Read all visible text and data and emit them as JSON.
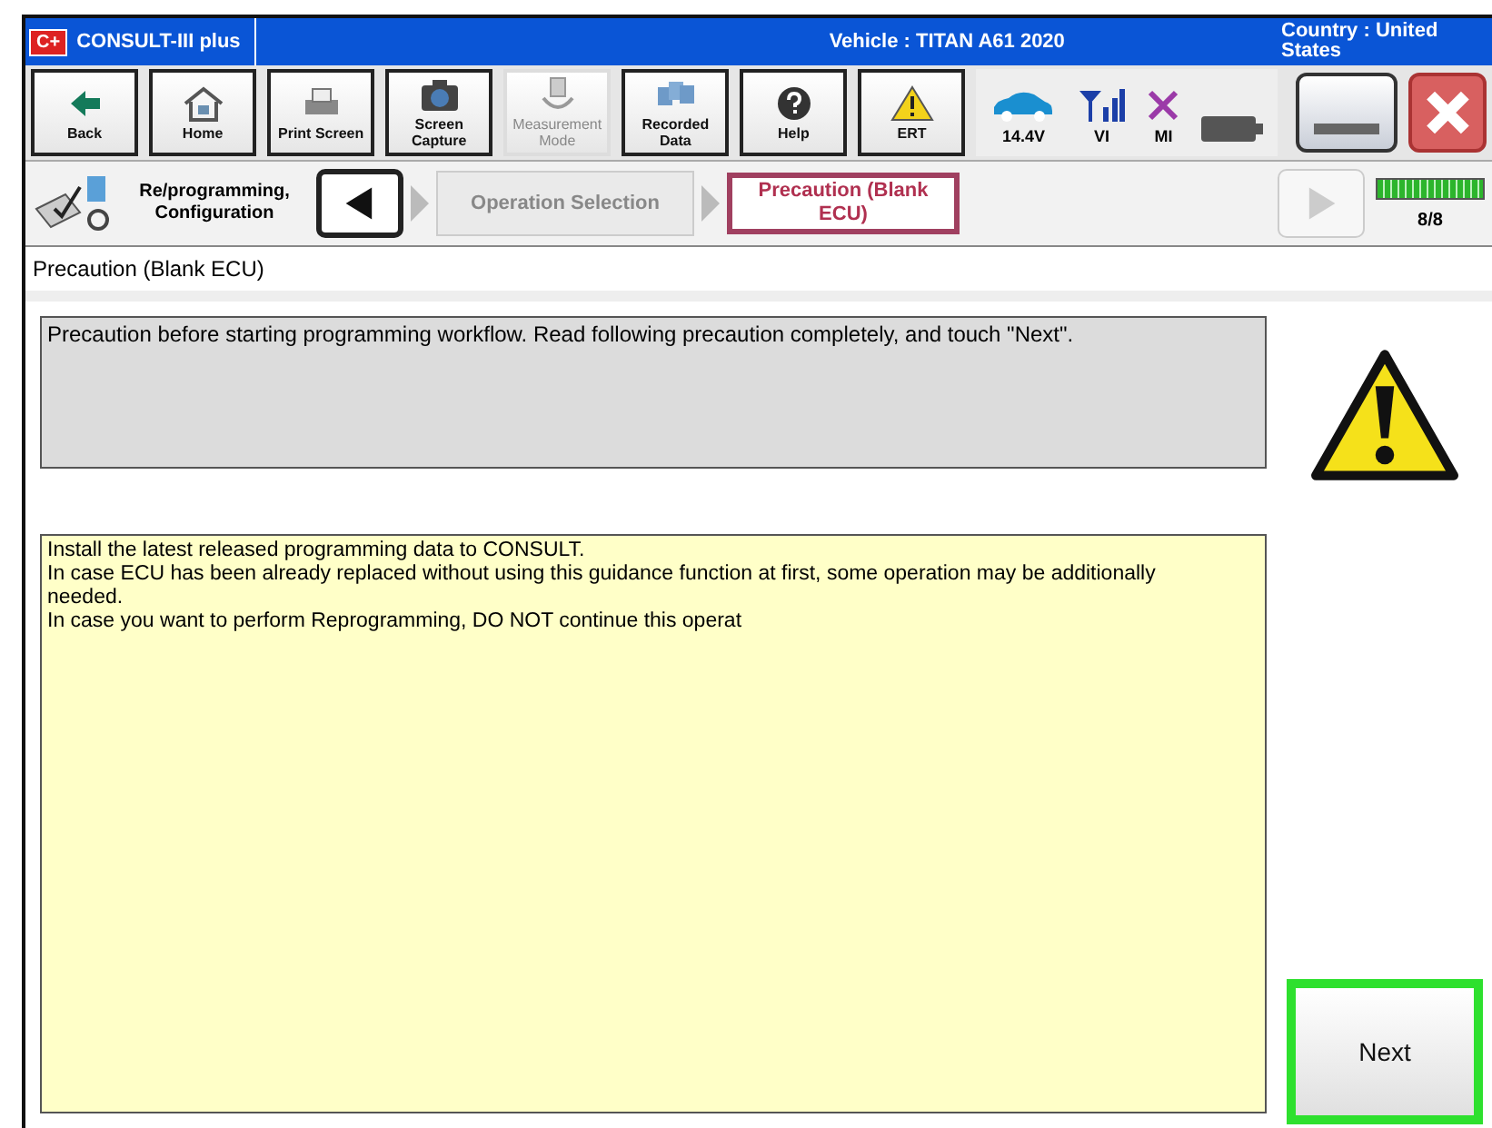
{
  "window": {
    "logo": "C+",
    "app_title": "CONSULT-III plus",
    "vehicle": "Vehicle : TITAN A61 2020",
    "country": "Country : United States"
  },
  "toolbar": [
    {
      "kind": "back",
      "label": "Back",
      "disabled": false
    },
    {
      "kind": "home",
      "label": "Home",
      "disabled": false
    },
    {
      "kind": "print",
      "label": "Print Screen",
      "disabled": false
    },
    {
      "kind": "camera",
      "label": "Screen Capture",
      "disabled": false
    },
    {
      "kind": "meter",
      "label": "Measurement Mode",
      "disabled": true
    },
    {
      "kind": "data",
      "label": "Recorded Data",
      "disabled": false
    },
    {
      "kind": "help",
      "label": "Help",
      "disabled": false
    },
    {
      "kind": "warning",
      "label": "ERT",
      "disabled": false
    }
  ],
  "status": [
    {
      "kind": "car",
      "label": "14.4V"
    },
    {
      "kind": "signal",
      "label": "VI"
    },
    {
      "kind": "cross",
      "label": "MI"
    },
    {
      "kind": "battery"
    }
  ],
  "breadcrumb": {
    "section": "Re/programming, Configuration",
    "steps": [
      {
        "label": "Operation Selection",
        "selected": false
      },
      {
        "label": "Precaution (Blank ECU)",
        "selected": true
      }
    ],
    "forward_disabled": true,
    "progress": {
      "level": 1,
      "reading": "8/8"
    }
  },
  "page_title": "Precaution (Blank ECU)",
  "instruction": "Precaution before starting programming workflow. Read following precaution completely, and touch \"Next\".",
  "precaution_lines": [
    "Install the latest released programming data to CONSULT.",
    "In case ECU has been already replaced without using this guidance function at first, some operation may be additionally needed.",
    "In case you want to perform Reprogramming, DO NOT continue this operat"
  ],
  "next_button": "Next"
}
